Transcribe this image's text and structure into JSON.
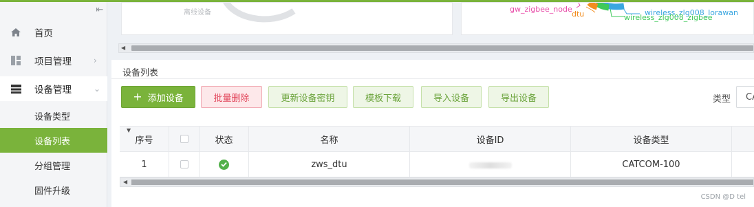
{
  "sidebar": {
    "items": [
      {
        "label": "首页",
        "icon": "home-icon"
      },
      {
        "label": "项目管理",
        "icon": "dashboard-icon"
      },
      {
        "label": "设备管理",
        "icon": "device-icon"
      }
    ],
    "sub_items": [
      {
        "label": "设备类型"
      },
      {
        "label": "设备列表"
      },
      {
        "label": "分组管理"
      },
      {
        "label": "固件升级"
      }
    ],
    "active_sub": "设备列表"
  },
  "charts": {
    "left_label": "离线设备",
    "right_labels": [
      "gw_zigbee_node",
      "dtu",
      "wireless_zlg008_lorawan",
      "wireless_zlg008_zigbee"
    ],
    "right_colors": [
      "#e84aa8",
      "#f28c1e",
      "#3aa6e0",
      "#3ec95a"
    ]
  },
  "panel": {
    "title": "设备列表"
  },
  "toolbar": {
    "add_label": "添加设备",
    "delete_label": "批量删除",
    "update_key_label": "更新设备密钥",
    "template_label": "模板下载",
    "import_label": "导入设备",
    "export_label": "导出设备",
    "type_label": "类型",
    "type_value": "CA"
  },
  "table": {
    "headers": [
      "序号",
      "",
      "状态",
      "名称",
      "设备ID",
      "设备类型"
    ],
    "rows": [
      {
        "index": "1",
        "status": "ok",
        "name": "zws_dtu",
        "device_type": "CATCOM-100"
      }
    ]
  },
  "watermark": "CSDN @D tel",
  "colors": {
    "accent": "#7ab33b",
    "danger": "#e2475c",
    "status_ok": "#52b04a"
  }
}
